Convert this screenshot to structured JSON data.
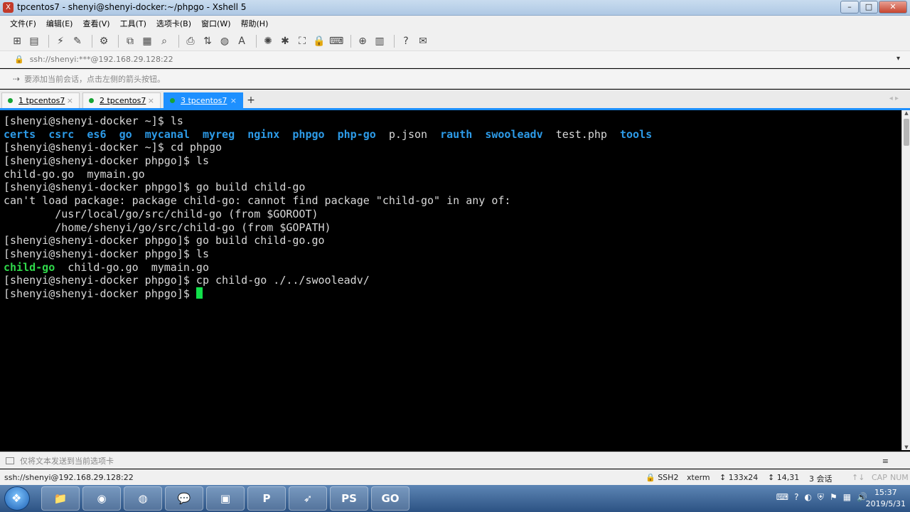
{
  "window": {
    "title": "tpcentos7 - shenyi@shenyi-docker:~/phpgo - Xshell 5",
    "controls": [
      "–",
      "□",
      "✕"
    ]
  },
  "menu": [
    "文件(F)",
    "编辑(E)",
    "查看(V)",
    "工具(T)",
    "选项卡(B)",
    "窗口(W)",
    "帮助(H)"
  ],
  "address": {
    "text": "ssh://shenyi:***@192.168.29.128:22"
  },
  "hint": {
    "text": "要添加当前会话，点击左侧的箭头按钮。"
  },
  "tabs": [
    {
      "label": "1 tpcentos7",
      "active": false
    },
    {
      "label": "2 tpcentos7",
      "active": false
    },
    {
      "label": "3 tpcentos7",
      "active": true
    }
  ],
  "terminal": {
    "lines": [
      [
        {
          "t": "[shenyi@shenyi-docker ~]$ ls",
          "c": "plain"
        }
      ],
      [
        {
          "t": "certs",
          "c": "dir"
        },
        {
          "t": "  ",
          "c": "plain"
        },
        {
          "t": "csrc",
          "c": "dir"
        },
        {
          "t": "  ",
          "c": "plain"
        },
        {
          "t": "es6",
          "c": "dir"
        },
        {
          "t": "  ",
          "c": "plain"
        },
        {
          "t": "go",
          "c": "dir"
        },
        {
          "t": "  ",
          "c": "plain"
        },
        {
          "t": "mycanal",
          "c": "dir"
        },
        {
          "t": "  ",
          "c": "plain"
        },
        {
          "t": "myreg",
          "c": "dir"
        },
        {
          "t": "  ",
          "c": "plain"
        },
        {
          "t": "nginx",
          "c": "dir"
        },
        {
          "t": "  ",
          "c": "plain"
        },
        {
          "t": "phpgo",
          "c": "dir"
        },
        {
          "t": "  ",
          "c": "plain"
        },
        {
          "t": "php-go",
          "c": "dir"
        },
        {
          "t": "  ",
          "c": "plain"
        },
        {
          "t": "p.json",
          "c": "plain"
        },
        {
          "t": "  ",
          "c": "plain"
        },
        {
          "t": "rauth",
          "c": "dir"
        },
        {
          "t": "  ",
          "c": "plain"
        },
        {
          "t": "swooleadv",
          "c": "dir"
        },
        {
          "t": "  ",
          "c": "plain"
        },
        {
          "t": "test.php",
          "c": "plain"
        },
        {
          "t": "  ",
          "c": "plain"
        },
        {
          "t": "tools",
          "c": "dir"
        }
      ],
      [
        {
          "t": "[shenyi@shenyi-docker ~]$ cd phpgo",
          "c": "plain"
        }
      ],
      [
        {
          "t": "[shenyi@shenyi-docker phpgo]$ ls",
          "c": "plain"
        }
      ],
      [
        {
          "t": "child-go.go  mymain.go",
          "c": "plain"
        }
      ],
      [
        {
          "t": "[shenyi@shenyi-docker phpgo]$ go build child-go",
          "c": "plain"
        }
      ],
      [
        {
          "t": "can't load package: package child-go: cannot find package \"child-go\" in any of:",
          "c": "plain"
        }
      ],
      [
        {
          "t": "        /usr/local/go/src/child-go (from $GOROOT)",
          "c": "plain"
        }
      ],
      [
        {
          "t": "        /home/shenyi/go/src/child-go (from $GOPATH)",
          "c": "plain"
        }
      ],
      [
        {
          "t": "[shenyi@shenyi-docker phpgo]$ go build child-go.go",
          "c": "plain"
        }
      ],
      [
        {
          "t": "[shenyi@shenyi-docker phpgo]$ ls",
          "c": "plain"
        }
      ],
      [
        {
          "t": "child-go",
          "c": "exec"
        },
        {
          "t": "  child-go.go  mymain.go",
          "c": "plain"
        }
      ],
      [
        {
          "t": "[shenyi@shenyi-docker phpgo]$ cp child-go ./../swooleadv/",
          "c": "plain"
        }
      ],
      [
        {
          "t": "[shenyi@shenyi-docker phpgo]$ ",
          "c": "plain"
        },
        {
          "t": "",
          "c": "cursor"
        }
      ]
    ]
  },
  "compose": {
    "text": "仅将文本发送到当前选项卡"
  },
  "status": {
    "connection": "ssh://shenyi@192.168.29.128:22",
    "protocol": "SSH2",
    "term": "xterm",
    "size": "133x24",
    "position": "14,31",
    "sessions": "3 会话",
    "caps": "CAP",
    "num": "NUM"
  },
  "taskbar": {
    "apps": [
      "📁",
      "◉",
      "◍",
      "💬",
      "▣",
      "P",
      "➶",
      "PS",
      "GO"
    ],
    "time": "15:37",
    "date": "2019/5/31"
  },
  "colors": {
    "accent": "#1e90ff",
    "dir": "#2d9be8",
    "exec": "#2fd84a",
    "cursor": "#11e04a"
  }
}
